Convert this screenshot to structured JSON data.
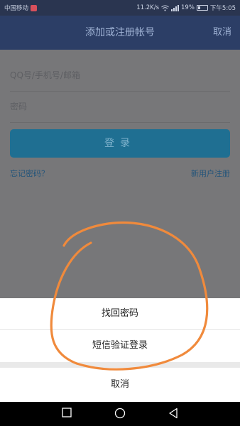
{
  "status_bar": {
    "carrier": "中国移动",
    "net_speed": "11.2K/s",
    "battery_percent": "19%",
    "time": "下午5:05"
  },
  "header": {
    "title": "添加或注册帐号",
    "cancel_label": "取消"
  },
  "login_form": {
    "account_placeholder": "QQ号/手机号/邮箱",
    "password_placeholder": "密码",
    "login_button": "登录",
    "forgot_password": "忘记密码？",
    "register": "新用户注册"
  },
  "action_sheet": {
    "find_password": "找回密码",
    "sms_login": "短信验证登录",
    "cancel": "取消"
  },
  "colors": {
    "header": "#2c3e66",
    "login_button": "#1f6f92",
    "annotation_stroke": "#f08a3c"
  },
  "icons": [
    "signal-icon",
    "wifi-icon",
    "battery-icon",
    "back-nav-icon",
    "home-nav-icon",
    "recent-apps-icon"
  ]
}
